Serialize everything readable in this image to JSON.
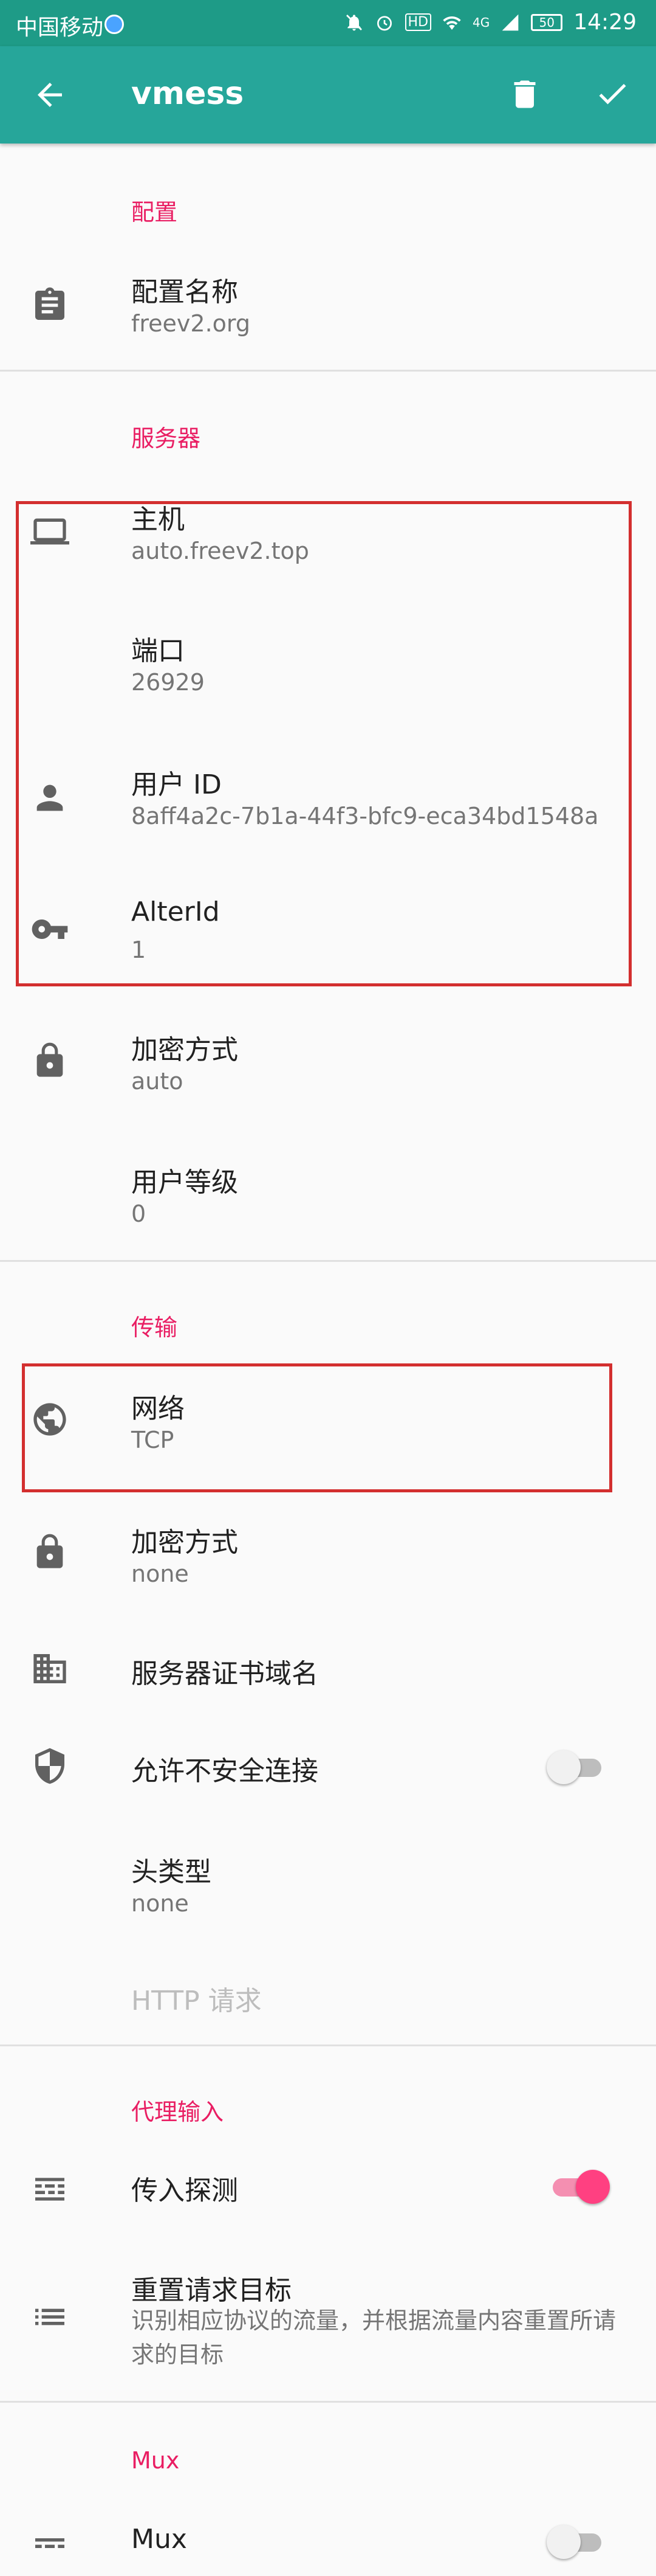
{
  "status_bar": {
    "carrier": "中国移动",
    "network": "4G",
    "battery": "50",
    "time": "14:29"
  },
  "toolbar": {
    "title": "vmess"
  },
  "sections": {
    "config": "配置",
    "server": "服务器",
    "transport": "传输",
    "proxy_in": "代理输入",
    "mux": "Mux"
  },
  "config": {
    "name_label": "配置名称",
    "name_value": "freev2.org"
  },
  "server": {
    "host_label": "主机",
    "host_value": "auto.freev2.top",
    "port_label": "端口",
    "port_value": "26929",
    "uid_label": "用户 ID",
    "uid_value": "8aff4a2c-7b1a-44f3-bfc9-eca34bd1548a",
    "alterid_label": "AlterId",
    "alterid_value": "1",
    "encrypt_label": "加密方式",
    "encrypt_value": "auto",
    "level_label": "用户等级",
    "level_value": "0"
  },
  "transport": {
    "network_label": "网络",
    "network_value": "TCP",
    "security_label": "加密方式",
    "security_value": "none",
    "sni_label": "服务器证书域名",
    "insecure_label": "允许不安全连接",
    "insecure_on": false,
    "header_label": "头类型",
    "header_value": "none",
    "http_label": "HTTP 请求"
  },
  "proxy_in": {
    "sniff_label": "传入探测",
    "sniff_on": true,
    "reroute_label": "重置请求目标",
    "reroute_desc": "识别相应协议的流量，并根据流量内容重置所请求的目标"
  },
  "mux": {
    "label": "Mux",
    "on": false
  },
  "colors": {
    "toolbar": "#26a69a",
    "statusbar": "#1e9b87",
    "accent": "#e91e63",
    "highlight_box": "#d32f2f"
  },
  "icons": [
    "arrow-back-icon",
    "trash-icon",
    "check-icon",
    "clipboard-icon",
    "laptop-icon",
    "person-icon",
    "key-icon",
    "lock-icon",
    "globe-icon",
    "lock-icon",
    "building-icon",
    "shield-icon",
    "sniff-icon",
    "list-icon",
    "mux-icon"
  ]
}
